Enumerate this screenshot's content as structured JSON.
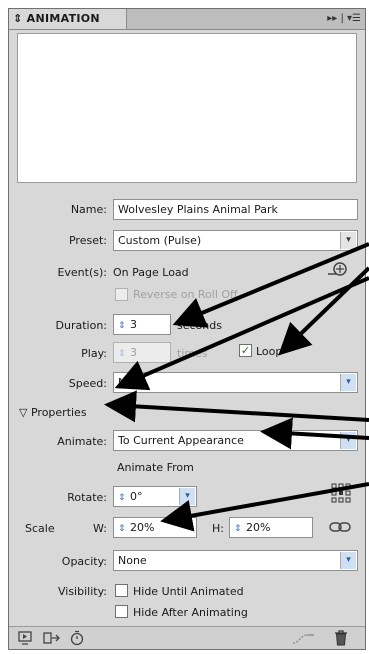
{
  "panel": {
    "tab_title": "ANIMATION",
    "tab_collapse_glyph": "⇕",
    "tab_controls": "▸▸ | ▾☰"
  },
  "form": {
    "name_label": "Name:",
    "name_value": "Wolvesley Plains Animal Park",
    "preset_label": "Preset:",
    "preset_value": "Custom (Pulse)",
    "events_label": "Event(s):",
    "events_value": "On Page Load",
    "reverse_label": "Reverse on Roll Off",
    "duration_label": "Duration:",
    "duration_value": "3",
    "duration_unit": "seconds",
    "play_label": "Play:",
    "play_value": "3",
    "play_unit": "times",
    "loop_label": "Loop",
    "loop_checked": true,
    "speed_label": "Speed:",
    "speed_value": "None",
    "properties_label": "Properties",
    "animate_label": "Animate:",
    "animate_value": "To Current Appearance",
    "animate_from_label": "Animate From",
    "rotate_label": "Rotate:",
    "rotate_value": "0°",
    "scale_label": "Scale",
    "scale_w_label": "W:",
    "scale_w_value": "20%",
    "scale_h_label": "H:",
    "scale_h_value": "20%",
    "opacity_label": "Opacity:",
    "opacity_value": "None",
    "visibility_label": "Visibility:",
    "hide_until_label": "Hide Until Animated",
    "hide_after_label": "Hide After Animating"
  },
  "icons": {
    "events_add": "events-add-icon",
    "origin_grid": "origin-grid-icon",
    "constrain_link": "link-icon",
    "preview": "preview-icon",
    "convert": "convert-icon",
    "timer": "timer-icon",
    "motion_path": "motion-path-icon",
    "delete": "trash-icon"
  }
}
